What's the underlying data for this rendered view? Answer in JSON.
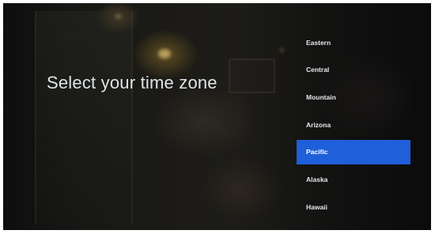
{
  "page": {
    "title": "Select your time zone"
  },
  "timezones": {
    "selected": "Pacific",
    "options": [
      {
        "label": "Eastern"
      },
      {
        "label": "Central"
      },
      {
        "label": "Mountain"
      },
      {
        "label": "Arizona"
      },
      {
        "label": "Pacific"
      },
      {
        "label": "Alaska"
      },
      {
        "label": "Hawaii"
      }
    ]
  },
  "colors": {
    "selection": "#1f5fd9",
    "text": "#e6e8ea",
    "background": "#141412"
  }
}
